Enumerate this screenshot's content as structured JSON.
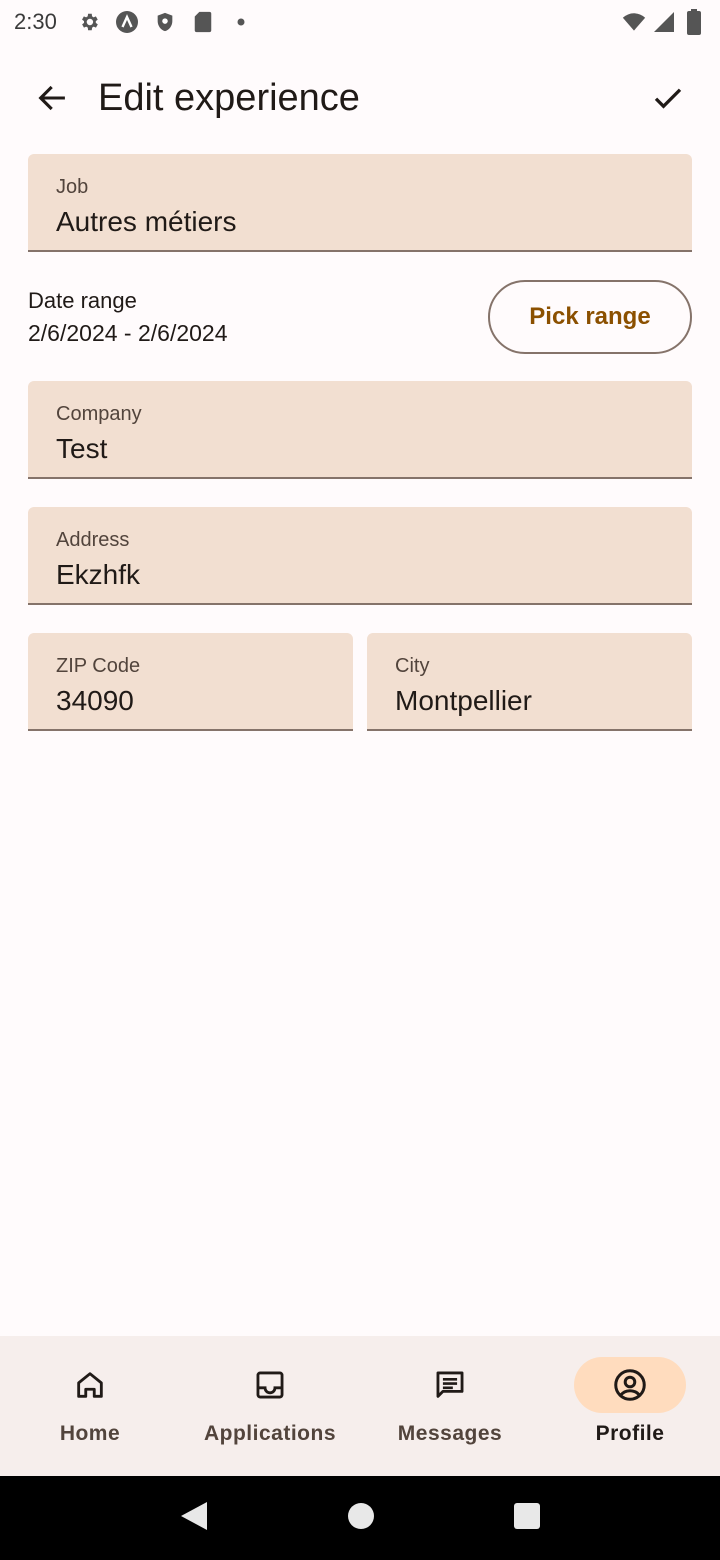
{
  "status_bar": {
    "time": "2:30"
  },
  "app_bar": {
    "title": "Edit experience"
  },
  "form": {
    "job": {
      "label": "Job",
      "value": "Autres métiers"
    },
    "date_range": {
      "label": "Date range",
      "value": "2/6/2024 - 2/6/2024",
      "button_label": "Pick range"
    },
    "company": {
      "label": "Company",
      "value": "Test"
    },
    "address": {
      "label": "Address",
      "value": "Ekzhfk"
    },
    "zip": {
      "label": "ZIP Code",
      "value": "34090"
    },
    "city": {
      "label": "City",
      "value": "Montpellier"
    }
  },
  "bottom_nav": {
    "items": [
      {
        "label": "Home",
        "icon": "home-icon",
        "active": false
      },
      {
        "label": "Applications",
        "icon": "inbox-icon",
        "active": false
      },
      {
        "label": "Messages",
        "icon": "message-icon",
        "active": false
      },
      {
        "label": "Profile",
        "icon": "account-circle-icon",
        "active": true
      }
    ]
  },
  "colors": {
    "field_bg": "#f2dfd1",
    "accent": "#8b5000",
    "active_indicator": "#ffdcbe",
    "nav_bg": "#f6eeec"
  }
}
